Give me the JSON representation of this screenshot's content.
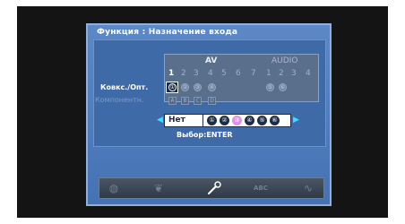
{
  "title": "Функция : Назначение входа",
  "groups": {
    "av": "AV",
    "audio": "AUDIO"
  },
  "av_numbers": [
    "1",
    "2",
    "3",
    "4",
    "5",
    "6",
    "7"
  ],
  "audio_numbers": [
    "1",
    "2",
    "3",
    "4"
  ],
  "rows": {
    "coax_opt": "Ковкс./Опт.",
    "component": "Компонентн."
  },
  "coax_icons": [
    "①",
    "②",
    "③",
    "④"
  ],
  "audio_coax_icons": [
    "⑤",
    "⑥"
  ],
  "component_icons": [
    "A",
    "B",
    "C",
    "D"
  ],
  "chooser": {
    "none_label": "Нет",
    "options": [
      "①",
      "②",
      "③",
      "④",
      "⑤",
      "⑥"
    ],
    "selected_index": 2
  },
  "hint": "Выбор:ENTER",
  "toolbar_icons": [
    "globe-icon",
    "leaf-icon",
    "wrench-icon",
    "abc-icon",
    "waveform-icon"
  ],
  "colors": {
    "osd_blue": "#4f7cbd",
    "highlight_magenta": "#e28fe6",
    "arrow_cyan": "#37e0ff"
  }
}
